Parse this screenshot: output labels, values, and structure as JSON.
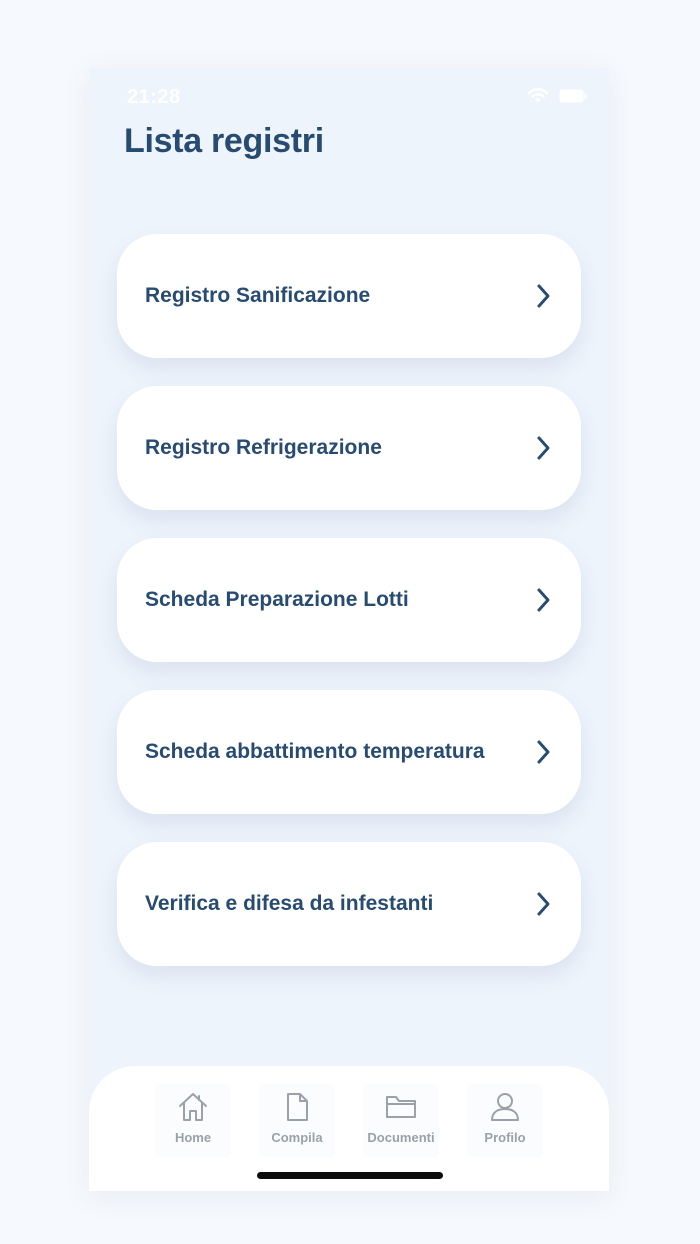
{
  "status_bar": {
    "time": "21:28",
    "wifi_icon": "wifi-icon",
    "battery_icon": "battery-icon"
  },
  "header": {
    "title": "Lista registri"
  },
  "registers": [
    {
      "label": "Registro Sanificazione",
      "icon": "chevron-right-icon"
    },
    {
      "label": "Registro Refrigerazione",
      "icon": "chevron-right-icon"
    },
    {
      "label": "Scheda Preparazione Lotti",
      "icon": "chevron-right-icon"
    },
    {
      "label": "Scheda abbattimento temperatura",
      "icon": "chevron-right-icon"
    },
    {
      "label": "Verifica e difesa da infestanti",
      "icon": "chevron-right-icon"
    }
  ],
  "tab_bar": {
    "tabs": [
      {
        "label": "Home",
        "icon": "home-icon"
      },
      {
        "label": "Compila",
        "icon": "file-icon"
      },
      {
        "label": "Documenti",
        "icon": "folder-icon"
      },
      {
        "label": "Profilo",
        "icon": "user-icon"
      }
    ]
  },
  "colors": {
    "accent": "#284b72",
    "background": "#eef4fc",
    "card": "#ffffff",
    "tab_label": "#9aa1a9"
  }
}
